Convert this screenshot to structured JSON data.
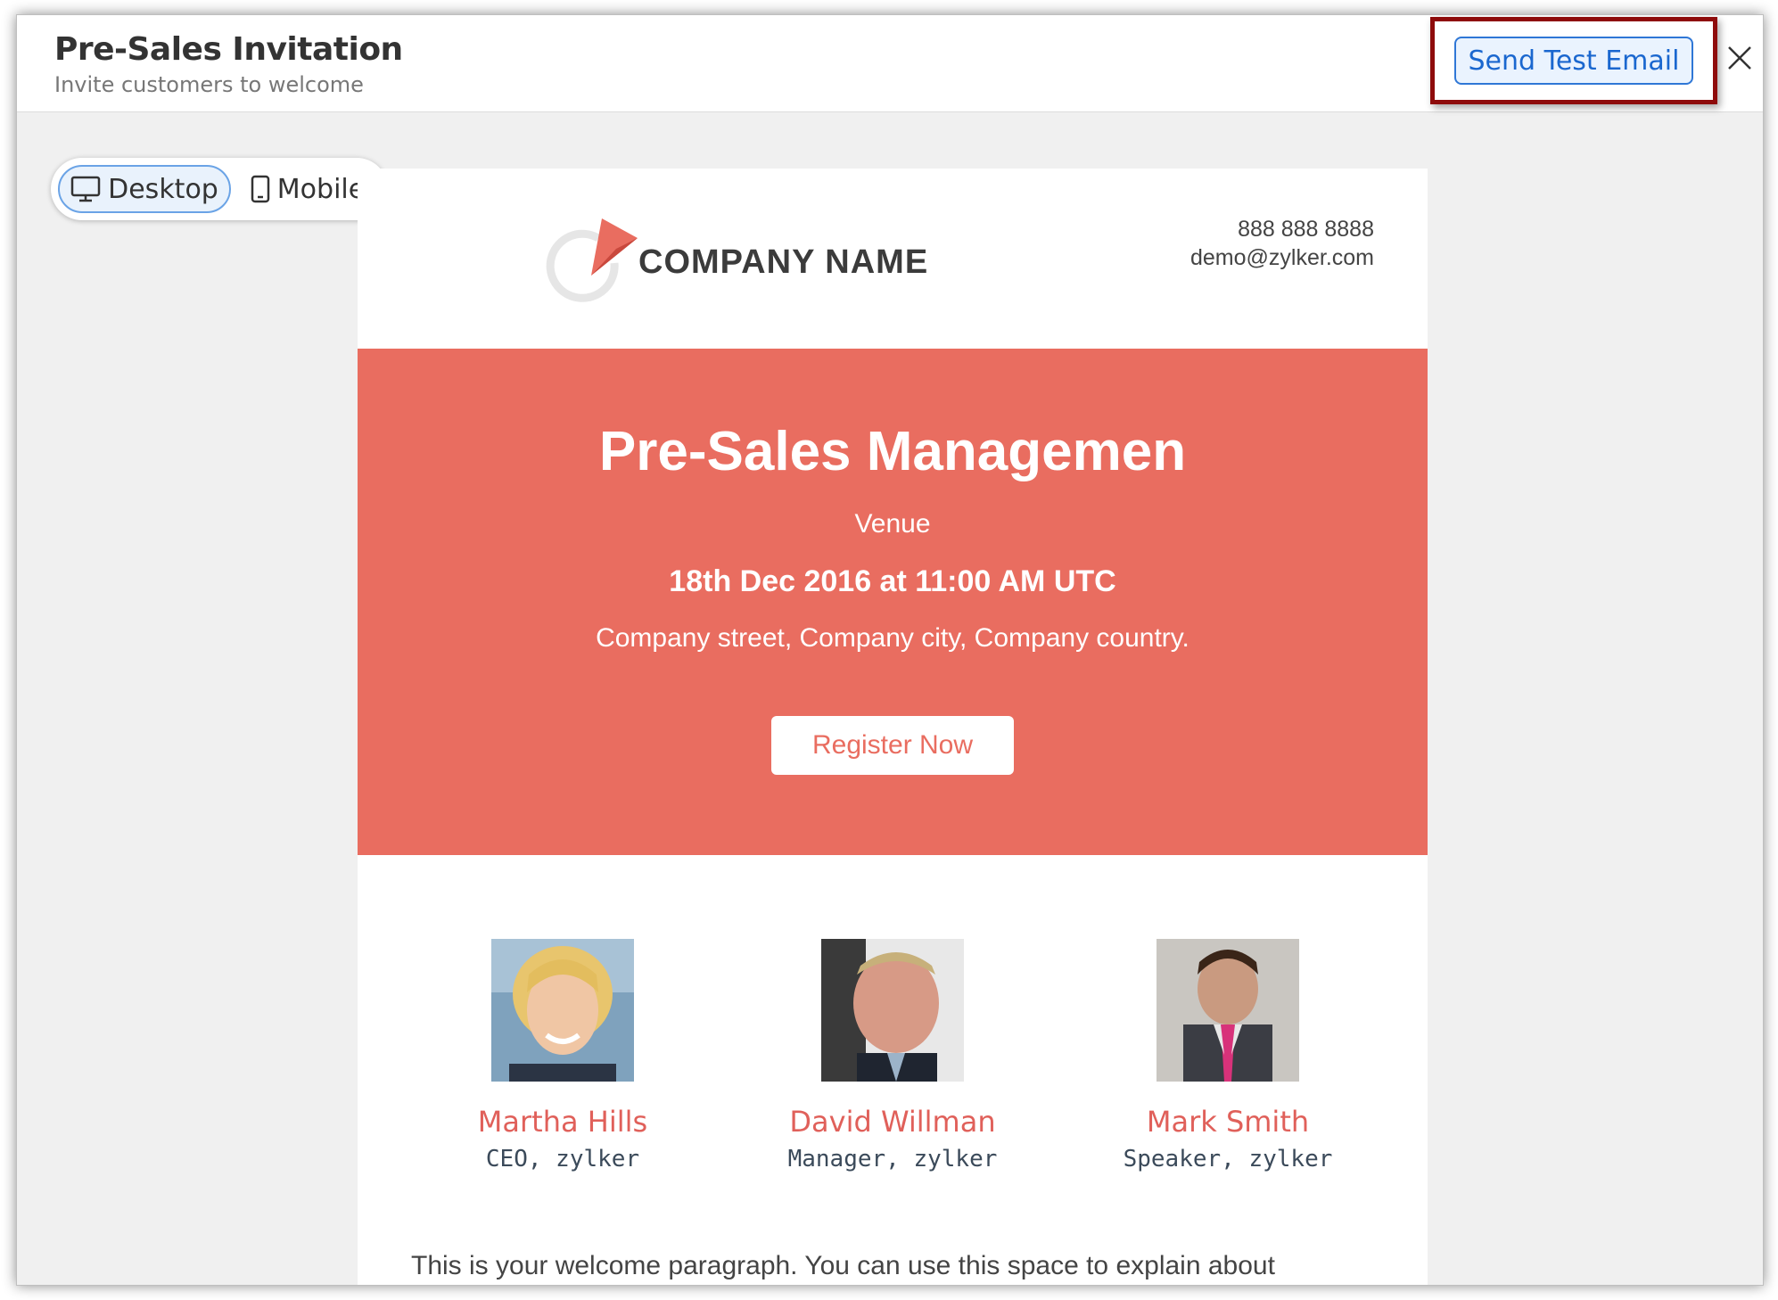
{
  "header": {
    "title": "Pre-Sales Invitation",
    "subtitle": "Invite customers to welcome",
    "send_test_label": "Send Test Email"
  },
  "view_toggle": {
    "desktop_label": "Desktop",
    "mobile_label": "Mobile",
    "selected": "Desktop"
  },
  "email": {
    "company_name": "COMPANY NAME",
    "phone": "888 888 8888",
    "contact_email": "demo@zylker.com",
    "hero": {
      "title": "Pre-Sales Managemen",
      "venue": "Venue",
      "date": "18th Dec 2016 at 11:00 AM UTC",
      "address": "Company street, Company city, Company country.",
      "register_label": "Register Now",
      "bg_color": "#e96d60"
    },
    "speakers": [
      {
        "name": "Martha Hills",
        "role": "CEO, zylker"
      },
      {
        "name": "David Willman",
        "role": "Manager, zylker"
      },
      {
        "name": "Mark Smith",
        "role": "Speaker, zylker"
      }
    ],
    "welcome_text": "This is your welcome paragraph. You can use this space to explain about"
  },
  "colors": {
    "accent_blue": "#1a67cf",
    "highlight_border": "#8e0b0b",
    "speaker_name": "#e0605a"
  }
}
